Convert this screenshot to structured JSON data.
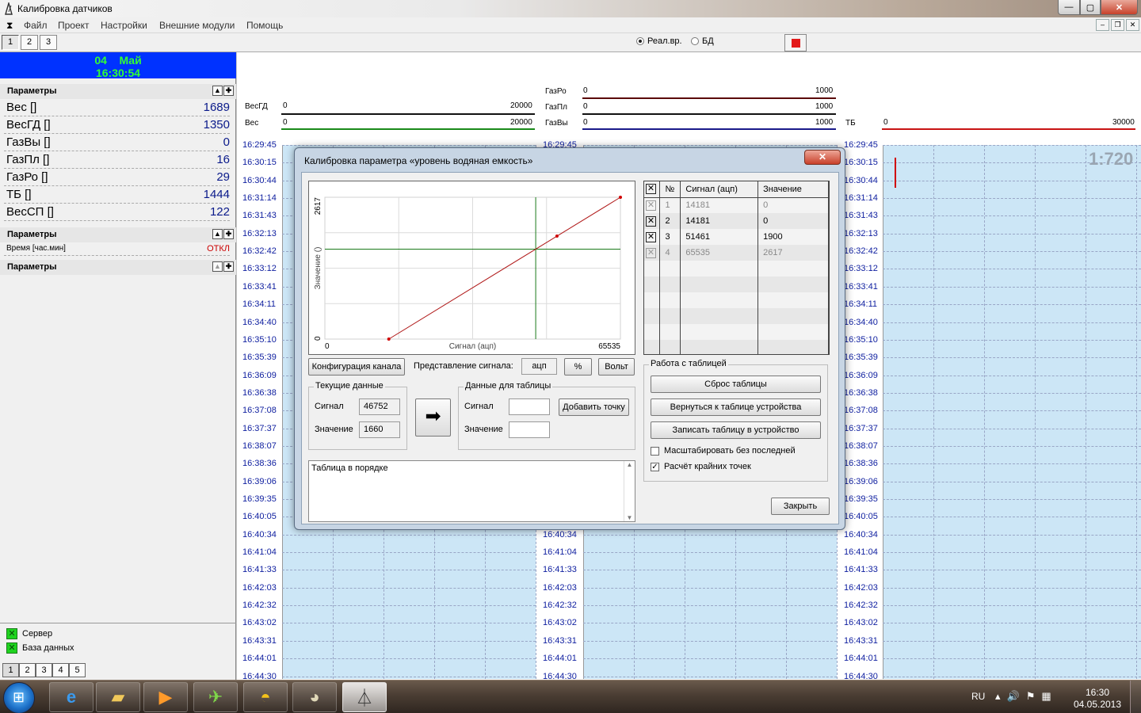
{
  "window": {
    "title": "Калибровка датчиков",
    "minimize": "—",
    "maximize": "▢",
    "close": "✕"
  },
  "menu": [
    "Файл",
    "Проект",
    "Настройки",
    "Внешние модули",
    "Помощь"
  ],
  "toolbar": {
    "tabs": [
      "1",
      "2",
      "3"
    ],
    "radio_realtime": "Реал.вр.",
    "radio_db": "БД"
  },
  "left": {
    "date": "04    Май",
    "time": "16:30:54",
    "group1_title": "Параметры",
    "group1_items": [
      {
        "name": "Вес []",
        "value": "1689"
      },
      {
        "name": "ВесГД []",
        "value": "1350"
      },
      {
        "name": "ГазВы []",
        "value": "0"
      },
      {
        "name": "ГазПл []",
        "value": "16"
      },
      {
        "name": "ГазРо []",
        "value": "29"
      },
      {
        "name": "ТБ []",
        "value": "1444"
      },
      {
        "name": "ВесСП []",
        "value": "122"
      }
    ],
    "group2_title": "Параметры",
    "group2_items": [
      {
        "name": "Время [час.мин]",
        "value": "ОТКЛ"
      }
    ],
    "group3_title": "Параметры",
    "status_server": "Сервер",
    "status_db": "База данных",
    "bottom_tabs": [
      "1",
      "2",
      "3",
      "4",
      "5"
    ]
  },
  "scales": {
    "ves_gd": {
      "name": "ВесГД",
      "min": "0",
      "max": "20000"
    },
    "ves": {
      "name": "Вес",
      "min": "0",
      "max": "20000"
    },
    "gaz_ro": {
      "name": "ГазРо",
      "min": "0",
      "max": "1000"
    },
    "gaz_pl": {
      "name": "ГазПл",
      "min": "0",
      "max": "1000"
    },
    "gaz_vy": {
      "name": "ГазВы",
      "min": "0",
      "max": "1000"
    },
    "tb": {
      "name": "ТБ",
      "min": "0",
      "max": "30000"
    }
  },
  "time_labels": [
    "16:29:45",
    "16:30:15",
    "16:30:44",
    "16:31:14",
    "16:31:43",
    "16:32:13",
    "16:32:42",
    "16:33:12",
    "16:33:41",
    "16:34:11",
    "16:34:40",
    "16:35:10",
    "16:35:39",
    "16:36:09",
    "16:36:38",
    "16:37:08",
    "16:37:37",
    "16:38:07",
    "16:38:36",
    "16:39:06",
    "16:39:35",
    "16:40:05",
    "16:40:34",
    "16:41:04",
    "16:41:33",
    "16:42:03",
    "16:42:32",
    "16:43:02",
    "16:43:31",
    "16:44:01",
    "16:44:30"
  ],
  "ratio": "1:720",
  "dialog": {
    "title": "Калибровка параметра «уровень водяная емкость»",
    "close_label": "✕",
    "btn_config": "Конфигурация канала",
    "signal_repr_label": "Представление сигнала:",
    "signal_repr_value": "ацп",
    "btn_percent": "%",
    "btn_volt": "Вольт",
    "current_title": "Текущие данные",
    "current_signal_label": "Сигнал",
    "current_signal_value": "46752",
    "current_value_label": "Значение",
    "current_value_value": "1660",
    "arrow": "➡",
    "table_data_title": "Данные для таблицы",
    "td_signal_label": "Сигнал",
    "td_value_label": "Значение",
    "btn_add_point": "Добавить точку",
    "memo_text": "Таблица в порядке",
    "grid_headers": [
      "№",
      "Сигнал (ацп)",
      "Значение"
    ],
    "grid_rows": [
      {
        "n": "1",
        "signal": "14181",
        "value": "0"
      },
      {
        "n": "2",
        "signal": "14181",
        "value": "0"
      },
      {
        "n": "3",
        "signal": "51461",
        "value": "1900"
      },
      {
        "n": "4",
        "signal": "65535",
        "value": "2617"
      }
    ],
    "work_title": "Работа с таблицей",
    "btn_reset": "Сброс таблицы",
    "btn_return": "Вернуться к таблице устройства",
    "btn_write": "Записать таблицу в устройство",
    "chk_scale": "Масштабировать без последней",
    "chk_calc": "Расчёт крайних точек",
    "btn_close": "Закрыть"
  },
  "chart_data": {
    "type": "line",
    "xlabel": "Сигнал (ацп)",
    "ylabel": "Значение ()",
    "xlim": [
      0,
      65535
    ],
    "ylim": [
      0,
      2617
    ],
    "x_ticks": [
      "0",
      "65535"
    ],
    "y_ticks": [
      "0",
      "2617"
    ],
    "grid": true,
    "series": [
      {
        "points": [
          [
            14181,
            0
          ],
          [
            51461,
            1900
          ],
          [
            65535,
            2617
          ]
        ]
      }
    ],
    "cursor": {
      "x": 46752,
      "y": 1660
    }
  },
  "taskbar": {
    "lang": "RU",
    "time": "16:30",
    "date": "04.05.2013"
  },
  "colors": {
    "selection_blue": "#0032ff",
    "date_text_green": "#33ff33",
    "strip_blue": "#cce6f6",
    "trace_red": "#d00000"
  }
}
